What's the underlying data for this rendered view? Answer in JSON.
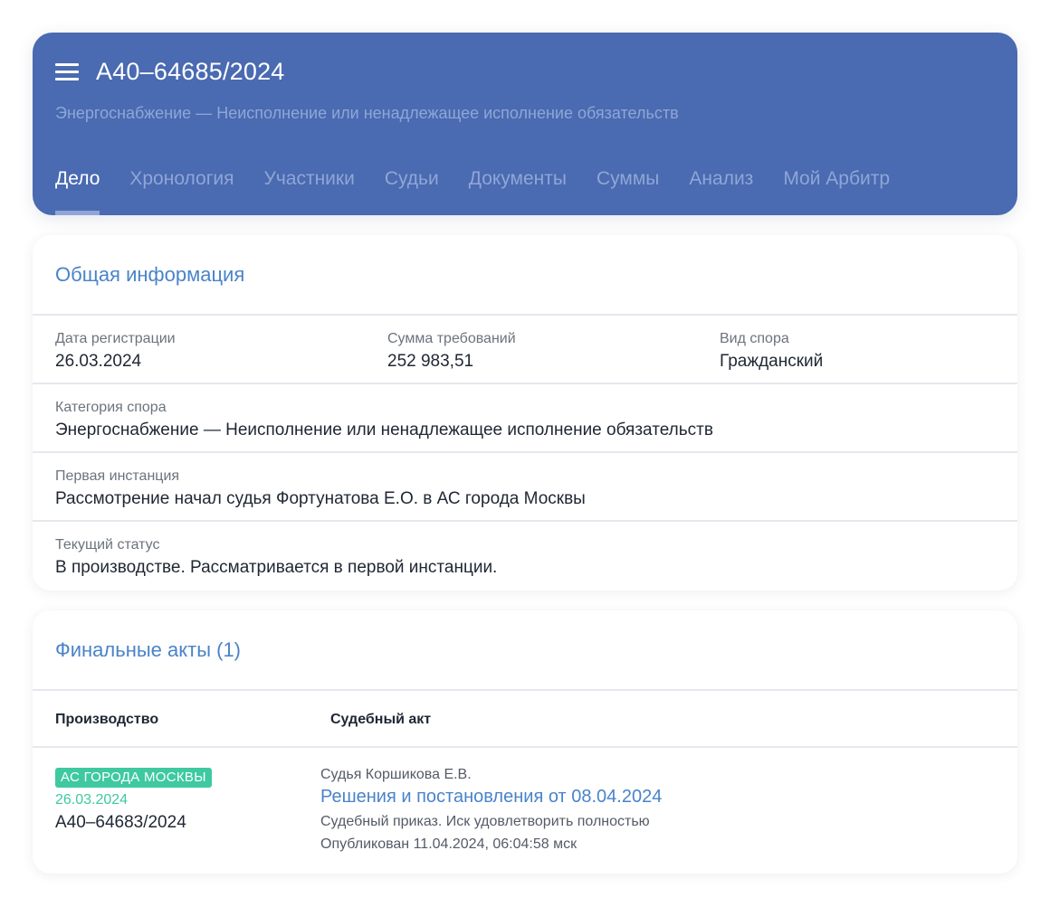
{
  "header": {
    "case_number": "А40–64685/2024",
    "subtitle": "Энергоснабжение — Неисполнение или ненадлежащее исполнение обязательств",
    "tabs": [
      {
        "label": "Дело",
        "active": true
      },
      {
        "label": "Хронология",
        "active": false
      },
      {
        "label": "Участники",
        "active": false
      },
      {
        "label": "Судьи",
        "active": false
      },
      {
        "label": "Документы",
        "active": false
      },
      {
        "label": "Суммы",
        "active": false
      },
      {
        "label": "Анализ",
        "active": false
      },
      {
        "label": "Мой Арбитр",
        "active": false
      }
    ]
  },
  "general_info": {
    "title": "Общая информация",
    "registration_date": {
      "label": "Дата регистрации",
      "value": "26.03.2024"
    },
    "claim_amount": {
      "label": "Сумма требований",
      "value": "252 983,51"
    },
    "dispute_type": {
      "label": "Вид спора",
      "value": "Гражданский"
    },
    "dispute_category": {
      "label": "Категория спора",
      "value": "Энергоснабжение — Неисполнение или ненадлежащее исполнение обязательств"
    },
    "first_instance": {
      "label": "Первая инстанция",
      "value": "Рассмотрение начал судья Фортунатова Е.О. в АС города Москвы"
    },
    "current_status": {
      "label": "Текущий статус",
      "value": "В производстве. Рассматривается в первой инстанции."
    }
  },
  "final_acts": {
    "title": "Финальные акты (1)",
    "columns": {
      "proceeding": "Производство",
      "act": "Судебный акт"
    },
    "rows": [
      {
        "court": "АС ГОРОДА МОСКВЫ",
        "date": "26.03.2024",
        "case_number": "А40–64683/2024",
        "judge": "Судья Коршикова Е.В.",
        "act_title": "Решения и постановления от 08.04.2024",
        "description": "Судебный приказ. Иск удовлетворить полностью",
        "published": "Опубликован 11.04.2024, 06:04:58 мск"
      }
    ]
  },
  "colors": {
    "header_bg": "#4a6ab1",
    "accent_blue": "#4a83c9",
    "court_badge": "#3ec9a1"
  },
  "icons": {
    "menu": "hamburger-menu-icon"
  }
}
